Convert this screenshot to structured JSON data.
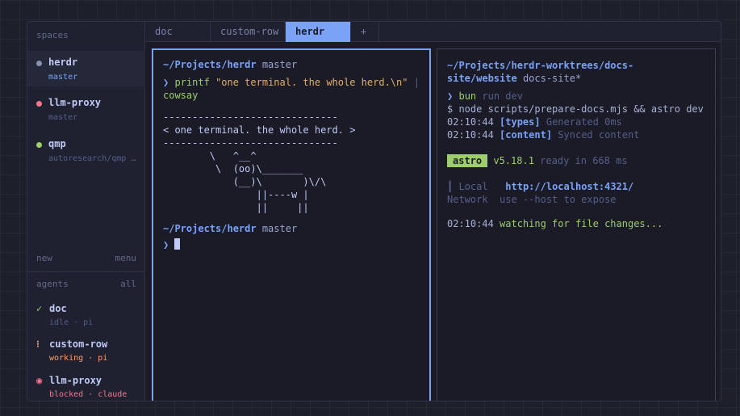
{
  "sidebar": {
    "spaces_title": "spaces",
    "spaces": [
      {
        "name": "herdr",
        "sub": "master",
        "color": "#8a90b0"
      },
      {
        "name": "llm-proxy",
        "sub": "master",
        "color": "#f7768e"
      },
      {
        "name": "qmp",
        "sub": "autoresearch/qmp …",
        "color": "#9ece6a"
      }
    ],
    "new_label": "new",
    "menu_label": "menu",
    "agents_title": "agents",
    "agents_all": "all",
    "agents": [
      {
        "icon": "✓",
        "name": "doc",
        "status": "idle · pi",
        "color": "#9ece6a",
        "sub_color": "#565f89"
      },
      {
        "icon": "⁝",
        "name": "custom-row",
        "status": "working · pi",
        "color": "#ff9e64",
        "sub_color": "#ff9e64"
      },
      {
        "icon": "◉",
        "name": "llm-proxy",
        "status": "blocked · claude",
        "color": "#f7768e",
        "sub_color": "#f7768e"
      }
    ]
  },
  "tabs": [
    "doc",
    "custom-row",
    "herdr",
    "+"
  ],
  "left_pane": {
    "path1": "~/Projects/herdr",
    "branch1": "master",
    "prompt": "❯",
    "cmd": "printf",
    "arg": "\"one terminal. the whole herd.\\n\"",
    "pipe": "|",
    "cmd2": "cowsay",
    "cow": [
      "------------------------------",
      "< one terminal. the whole herd. >",
      "------------------------------",
      "        \\   ^__^",
      "         \\  (oo)\\_______",
      "            (__)\\       )\\/\\",
      "                ||----w |",
      "                ||     ||"
    ],
    "path2": "~/Projects/herdr",
    "branch2": "master"
  },
  "right_pane": {
    "path_a": "~/Projects/herdr-worktrees/docs-",
    "path_b": "site/website",
    "branch": "docs-site*",
    "prompt": "❯",
    "cmd": "bun",
    "cmd_args": "run dev",
    "exec_line": "$ node scripts/prepare-docs.mjs && astro dev",
    "log1_time": "02:10:44",
    "log1_tag": "[types]",
    "log1_msg": "Generated 0ms",
    "log2_time": "02:10:44",
    "log2_tag": "[content]",
    "log2_msg": "Synced content",
    "astro_badge": "astro",
    "astro_version": "v5.18.1",
    "astro_ready": "ready in 668 ms",
    "local_bar": "┃",
    "local_label": "Local",
    "local_url": "http://localhost:4321/",
    "network_label": "Network",
    "network_msg": "use --host to expose",
    "watch_time": "02:10:44",
    "watch_msg": "watching for file changes..."
  }
}
